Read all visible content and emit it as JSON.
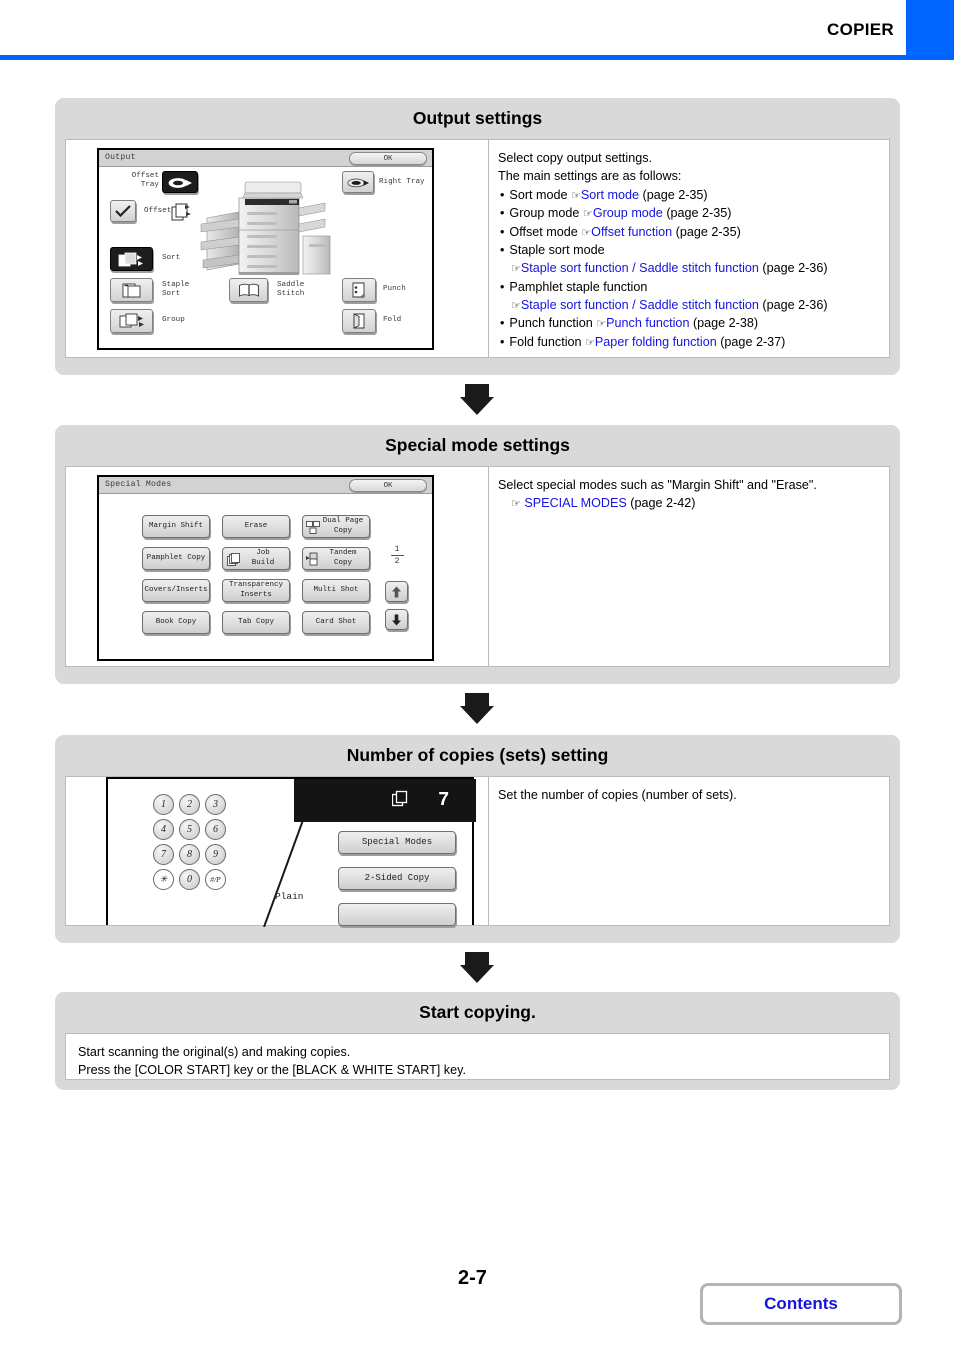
{
  "header": {
    "title": "COPIER",
    "accent_color": "#0066ff"
  },
  "sections": [
    {
      "id": "output-settings",
      "title": "Output settings",
      "description": {
        "line1": "Select copy output settings.",
        "line2": "The main settings are as follows:",
        "bullets": [
          {
            "pre": "Sort mode ",
            "hand": "☞",
            "link": "Sort mode",
            "post": " (page 2-35)"
          },
          {
            "pre": "Group mode ",
            "hand": "☞",
            "link": "Group mode",
            "post": " (page 2-35)"
          },
          {
            "pre": "Offset mode ",
            "hand": "☞",
            "link": "Offset function",
            "post": " (page 2-35)"
          },
          {
            "pre": "Staple sort mode",
            "hand": "☞",
            "link": "Staple sort function / Saddle stitch function",
            "post": " (page 2-36)",
            "wrap": true
          },
          {
            "pre": "Pamphlet staple function",
            "hand": "☞",
            "link": "Staple sort function / Saddle stitch function",
            "post": " (page 2-36)",
            "wrap": true
          },
          {
            "pre": "Punch function ",
            "hand": "☞",
            "link": "Punch function",
            "post": " (page 2-38)"
          },
          {
            "pre": "Fold function ",
            "hand": "☞",
            "link": "Paper folding function",
            "post": " (page 2-37)"
          }
        ]
      },
      "screen": {
        "title": "Output",
        "ok_label": "OK",
        "labels": {
          "offset_tray": "Offset\nTray",
          "offset": "Offset",
          "right_tray": "Right Tray",
          "sort": "Sort",
          "staple_sort": "Staple\nSort",
          "saddle_stitch": "Saddle\nStitch",
          "punch": "Punch",
          "group": "Group",
          "fold": "Fold"
        },
        "selected": [
          "offset-tray",
          "sort"
        ],
        "offset_checked": true
      }
    },
    {
      "id": "special-mode-settings",
      "title": "Special mode settings",
      "description": {
        "line1": "Select special modes such as \"Margin Shift\" and \"Erase\".",
        "hand": "☞",
        "link": "SPECIAL MODES",
        "post": " (page 2-42)"
      },
      "screen": {
        "title": "Special Modes",
        "ok_label": "OK",
        "page_indicator": {
          "current": "1",
          "total": "2"
        },
        "keys": [
          "Margin Shift",
          "Erase",
          "Dual Page\nCopy",
          "Pamphlet Copy",
          "Job\nBuild",
          "Tandem\nCopy",
          "Covers/Inserts",
          "Transparency\nInserts",
          "Multi Shot",
          "Book Copy",
          "Tab Copy",
          "Card Shot"
        ],
        "up_arrow": "⬆",
        "down_arrow": "⬇"
      }
    },
    {
      "id": "number-of-copies",
      "title": "Number of copies (sets) setting",
      "description": {
        "line1": "Set the number of copies (number of sets)."
      },
      "screen": {
        "keypad": [
          "1",
          "2",
          "3",
          "4",
          "5",
          "6",
          "7",
          "8",
          "9",
          "✳",
          "0",
          "#/P"
        ],
        "copy_count": "7",
        "buttons": [
          "Special Modes",
          "2-Sided Copy"
        ],
        "paper_label": "Plain"
      }
    },
    {
      "id": "start-copying",
      "title": "Start copying.",
      "description": {
        "line1": "Start scanning the original(s) and making copies.",
        "line2": "Press the [COLOR START] key or the [BLACK & WHITE START] key."
      }
    }
  ],
  "footer": {
    "page_number": "2-7",
    "contents_label": "Contents"
  }
}
